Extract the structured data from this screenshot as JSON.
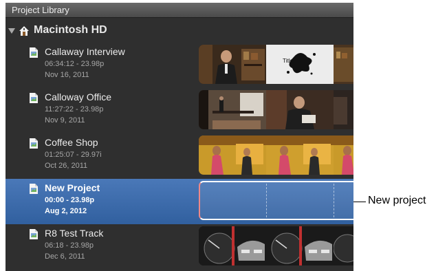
{
  "panel": {
    "title": "Project Library"
  },
  "volume": {
    "label": "Macintosh HD"
  },
  "projects": [
    {
      "name": "Callaway Interview",
      "timecode": "06:34:12 - 23.98p",
      "date": "Nov 16, 2011"
    },
    {
      "name": "Calloway Office",
      "timecode": "11:27:22 - 23.98p",
      "date": "Nov 9, 2011"
    },
    {
      "name": "Coffee Shop",
      "timecode": "01:25:07 - 29.97i",
      "date": "Oct 26, 2011"
    },
    {
      "name": "New Project",
      "timecode": "00:00 - 23.98p",
      "date": "Aug 2, 2012"
    },
    {
      "name": "R8 Test Track",
      "timecode": "06:18 - 23.98p",
      "date": "Dec 6, 2011"
    }
  ],
  "title_card": {
    "text": "Title"
  },
  "callout": {
    "label": "New project"
  },
  "colors": {
    "selection": "#31609f",
    "panel_bg": "#2f2f2f"
  }
}
